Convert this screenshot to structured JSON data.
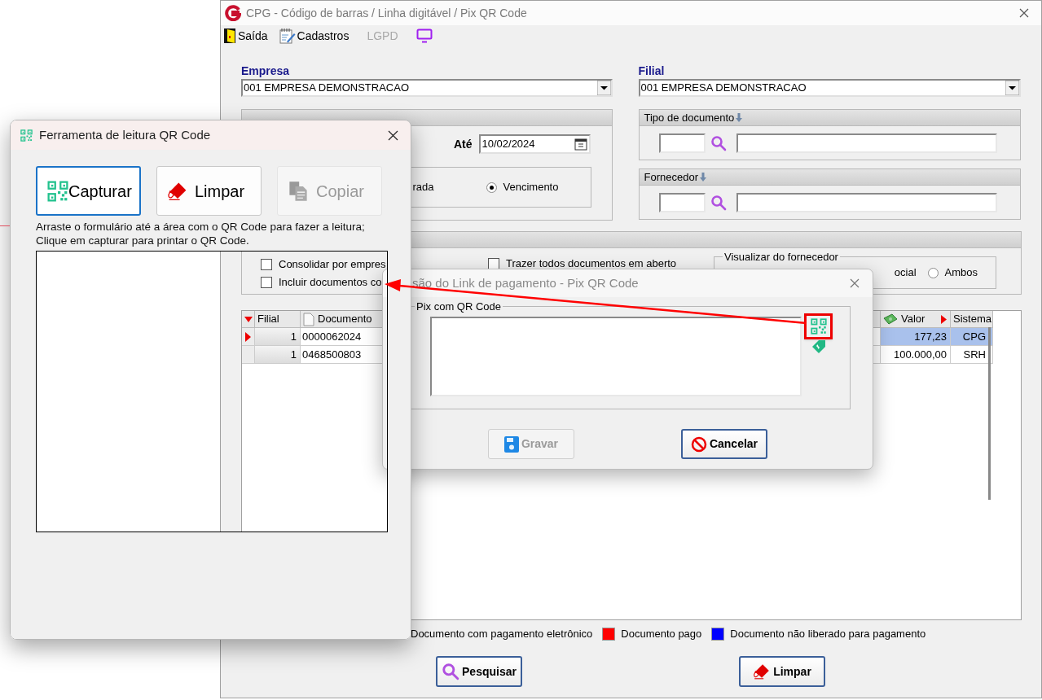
{
  "main_window": {
    "title": "CPG - Código de barras / Linha digitável / Pix QR Code",
    "toolbar": [
      {
        "kind": "exit",
        "label": "Saída",
        "disabled": false
      },
      {
        "kind": "records",
        "label": "Cadastros",
        "disabled": false
      },
      {
        "kind": "text",
        "label": "LGPD",
        "disabled": true
      },
      {
        "kind": "monitor"
      }
    ],
    "empresa": {
      "label": "Empresa",
      "value": "001 EMPRESA DEMONSTRACAO"
    },
    "filial": {
      "label": "Filial",
      "value": "001 EMPRESA DEMONSTRACAO"
    },
    "periodo": {
      "ate_label": "Até",
      "ate_value": "10/02/2024",
      "fragment": "rada",
      "radio": {
        "label": "Vencimento",
        "selected": true
      }
    },
    "tipo_documento": {
      "title": "Tipo de documento"
    },
    "fornecedor": {
      "title": "Fornecedor"
    },
    "options": {
      "checkboxes": [
        {
          "label": "Consolidar por empres",
          "checked": false
        },
        {
          "label": "Incluir documentos co",
          "checked": false
        },
        {
          "label": "Trazer todos documentos em aberto",
          "checked": false
        }
      ],
      "visualizar": {
        "title": "Visualizar do fornecedor",
        "fragment": "ocial",
        "radio": {
          "label": "Ambos",
          "selected": false
        }
      }
    },
    "grid": {
      "columns": [
        "Filial",
        "Documento",
        "Valor",
        "Sistema"
      ],
      "rows": [
        {
          "cells": [
            "1",
            "0000062024",
            "177,23",
            "CPG"
          ],
          "selected": true
        },
        {
          "cells": [
            "1",
            "0468500803",
            "100.000,00",
            "SRH"
          ],
          "selected": false
        }
      ]
    },
    "legend": [
      {
        "label": "Documento com pagamento eletrônico"
      },
      {
        "label": "Documento pago",
        "color": "#ff0000"
      },
      {
        "label": "Documento não liberado para pagamento",
        "color": "#0000ff"
      }
    ],
    "buttons": [
      {
        "kind": "search",
        "label": "Pesquisar"
      },
      {
        "kind": "clear",
        "label": "Limpar"
      }
    ]
  },
  "pix_dialog": {
    "title": "são do Link de pagamento - Pix QR Code",
    "group": "Pix com QR Code",
    "buttons": [
      {
        "kind": "save",
        "label": "Gravar",
        "disabled": true
      },
      {
        "kind": "cancel",
        "label": "Cancelar",
        "disabled": false
      }
    ]
  },
  "qr_tool": {
    "title": "Ferramenta de leitura QR Code",
    "buttons": [
      {
        "kind": "capture",
        "label": "Capturar",
        "focused": true,
        "disabled": false
      },
      {
        "kind": "clear",
        "label": "Limpar",
        "focused": false,
        "disabled": false
      },
      {
        "kind": "copy",
        "label": "Copiar",
        "focused": false,
        "disabled": true
      }
    ],
    "instructions": [
      "Arraste o formulário até a área com o QR Code para fazer a leitura;",
      "Clique em capturar para printar o QR Code."
    ]
  }
}
